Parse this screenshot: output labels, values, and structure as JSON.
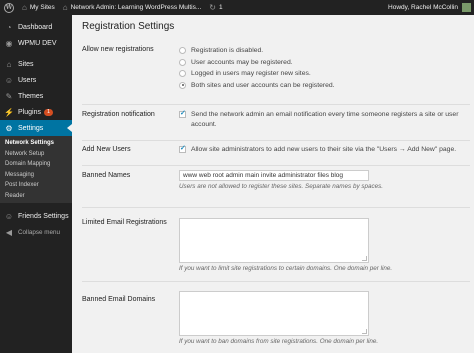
{
  "adminbar": {
    "my_sites": "My Sites",
    "network_admin": "Network Admin: Learning WordPress Multis...",
    "updates_count": "1",
    "greeting": "Howdy, Rachel McCollin"
  },
  "sidebar": {
    "items": [
      {
        "label": "Dashboard",
        "icon": "dashboard-icon"
      },
      {
        "label": "WPMU DEV",
        "icon": "wpmudev-icon"
      },
      {
        "label": "Sites",
        "icon": "sites-icon"
      },
      {
        "label": "Users",
        "icon": "users-icon"
      },
      {
        "label": "Themes",
        "icon": "themes-icon"
      },
      {
        "label": "Plugins",
        "icon": "plugins-icon",
        "badge": "1"
      },
      {
        "label": "Settings",
        "icon": "settings-icon"
      },
      {
        "label": "Friends Settings",
        "icon": "friends-icon"
      },
      {
        "label": "Collapse menu",
        "icon": "collapse-icon"
      }
    ],
    "submenu": [
      "Network Settings",
      "Network Setup",
      "Domain Mapping",
      "Messaging",
      "Post Indexer",
      "Reader"
    ]
  },
  "page": {
    "title": "Registration Settings",
    "allow_registrations": {
      "label": "Allow new registrations",
      "options": [
        "Registration is disabled.",
        "User accounts may be registered.",
        "Logged in users may register new sites.",
        "Both sites and user accounts can be registered."
      ],
      "selected_index": 3
    },
    "registration_notification": {
      "label": "Registration notification",
      "text": "Send the network admin an email notification every time someone registers a site or user account.",
      "checked": true
    },
    "add_new_users": {
      "label": "Add New Users",
      "text": "Allow site administrators to add new users to their site via the \"Users → Add New\" page.",
      "checked": true
    },
    "banned_names": {
      "label": "Banned Names",
      "value": "www web root admin main invite administrator files blog",
      "desc": "Users are not allowed to register these sites. Separate names by spaces."
    },
    "limited_email": {
      "label": "Limited Email Registrations",
      "desc": "If you want to limit site registrations to certain domains. One domain per line."
    },
    "banned_email": {
      "label": "Banned Email Domains",
      "desc": "If you want to ban domains from site registrations. One domain per line."
    }
  }
}
